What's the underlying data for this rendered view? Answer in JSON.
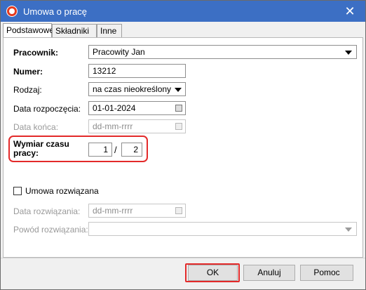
{
  "window": {
    "title": "Umowa o pracę",
    "close_glyph": "✕"
  },
  "tabs": [
    {
      "label": "Podstawowe"
    },
    {
      "label": "Składniki"
    },
    {
      "label": "Inne"
    }
  ],
  "form": {
    "employee": {
      "label": "Pracownik:",
      "value": "Pracowity Jan"
    },
    "number": {
      "label": "Numer:",
      "value": "13212"
    },
    "type": {
      "label": "Rodzaj:",
      "value": "na czas nieokreślony"
    },
    "start_date": {
      "label": "Data rozpoczęcia:",
      "value": "01-01-2024"
    },
    "end_date": {
      "label": "Data końca:",
      "placeholder": "dd-mm-rrrr"
    },
    "work_time": {
      "label_line1": "Wymiar czasu",
      "label_line2": "pracy:",
      "numerator": "1",
      "separator": "/",
      "denominator": "2"
    },
    "terminated": {
      "label": "Umowa rozwiązana",
      "checked": false
    },
    "termination_date": {
      "label": "Data rozwiązania:",
      "placeholder": "dd-mm-rrrr"
    },
    "termination_reason": {
      "label": "Powód rozwiązania:",
      "value": ""
    }
  },
  "buttons": {
    "ok": "OK",
    "cancel": "Anuluj",
    "help": "Pomoc"
  },
  "colors": {
    "titlebar": "#3c6fc4",
    "highlight": "#e32a2a"
  }
}
